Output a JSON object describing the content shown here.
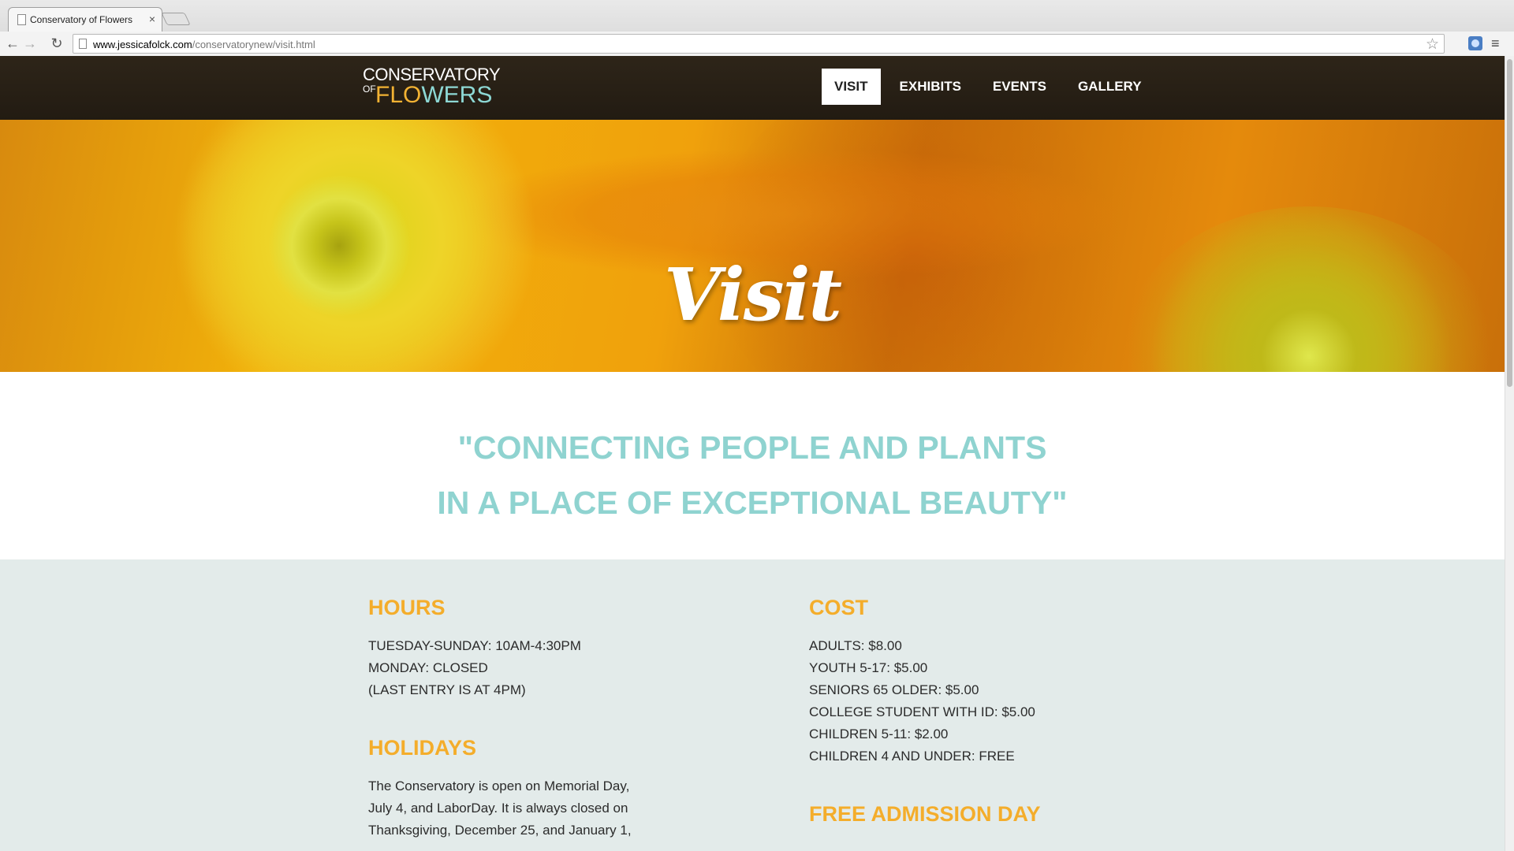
{
  "browser": {
    "tab_title": "Conservatory of Flowers",
    "close_glyph": "×",
    "url_host": "www.jessicafolck.com",
    "url_path": "/conservatorynew/visit.html",
    "back_glyph": "←",
    "forward_glyph": "→",
    "reload_glyph": "↻",
    "star_glyph": "☆",
    "menu_glyph": "≡"
  },
  "header": {
    "logo": {
      "top": "CONSERVATORY",
      "of": "OF",
      "flowers_warm": "FLO",
      "flowers_cool": "WERS"
    },
    "nav": [
      {
        "label": "VISIT",
        "active": true
      },
      {
        "label": "EXHIBITS",
        "active": false
      },
      {
        "label": "EVENTS",
        "active": false
      },
      {
        "label": "GALLERY",
        "active": false
      }
    ]
  },
  "hero": {
    "title": "Visit"
  },
  "tagline": {
    "line1": "\"CONNECTING PEOPLE AND PLANTS",
    "line2": "IN A PLACE OF EXCEPTIONAL BEAUTY\""
  },
  "hours": {
    "heading": "HOURS",
    "lines": [
      "TUESDAY-SUNDAY: 10AM-4:30PM",
      "MONDAY: CLOSED",
      "(LAST ENTRY IS AT 4PM)"
    ]
  },
  "holidays": {
    "heading": "HOLIDAYS",
    "lines": [
      "The Conservatory is open on Memorial Day,",
      "July 4, and LaborDay. It is always closed on",
      "Thanksgiving, December 25, and January 1,"
    ]
  },
  "cost": {
    "heading": "COST",
    "lines": [
      "ADULTS: $8.00",
      "YOUTH 5-17: $5.00",
      "SENIORS 65 OLDER: $5.00",
      "COLLEGE STUDENT WITH ID: $5.00",
      "CHILDREN 5-11: $2.00",
      "CHILDREN 4 AND UNDER: FREE"
    ]
  },
  "free_day": {
    "heading": "FREE ADMISSION DAY"
  },
  "colors": {
    "accent_orange": "#f4ad2b",
    "tagline_teal": "#8fd3d0",
    "info_bg": "#e3ebea",
    "header_bg": "#2e2519"
  },
  "icons": [
    "page-icon",
    "close-icon",
    "back-arrow-icon",
    "forward-arrow-icon",
    "reload-icon",
    "bookmark-star-icon",
    "extension-icon",
    "menu-icon"
  ]
}
